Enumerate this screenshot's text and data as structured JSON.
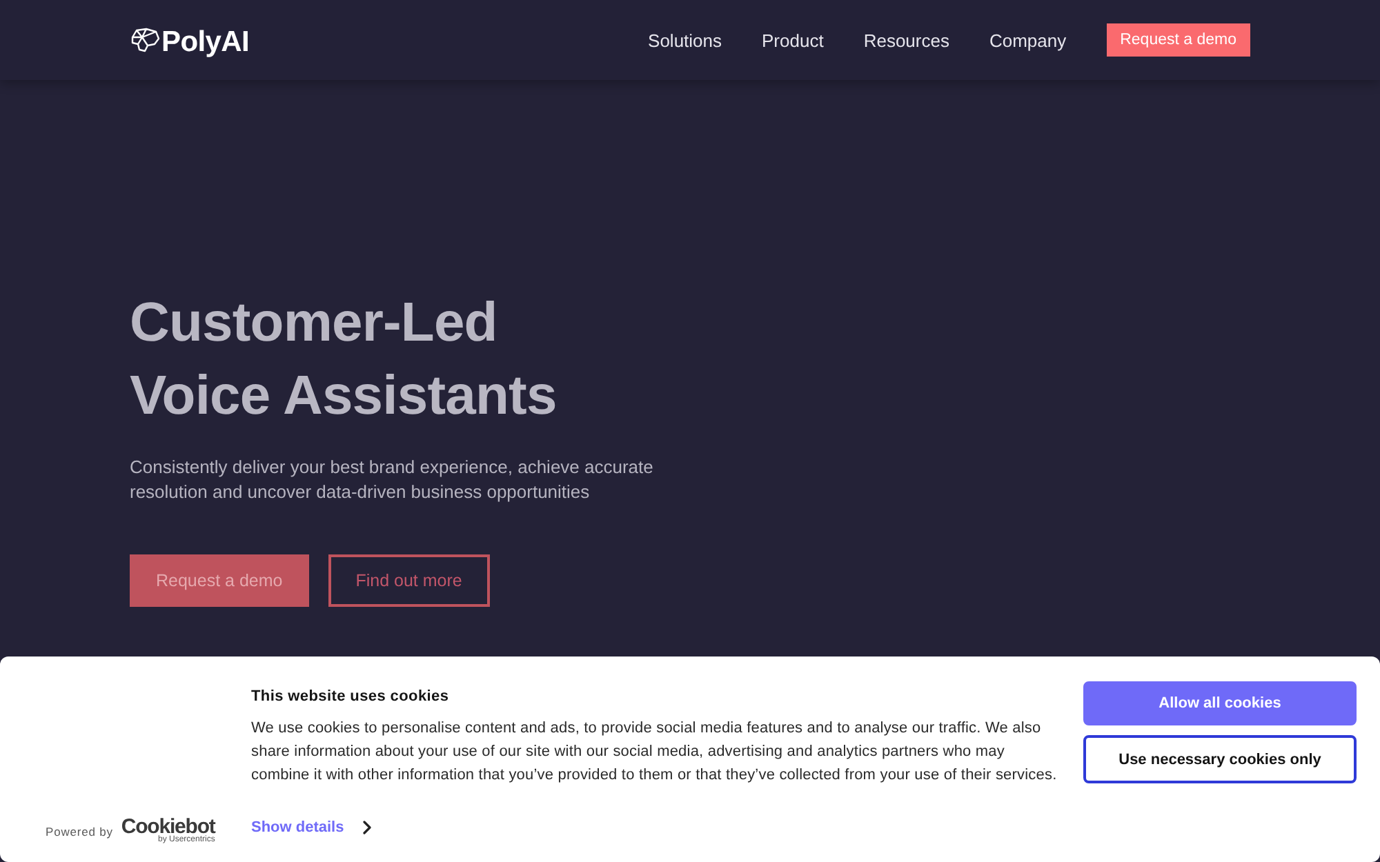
{
  "header": {
    "logo": "PolyAI",
    "nav": [
      "Solutions",
      "Product",
      "Resources",
      "Company"
    ],
    "cta": "Request a demo"
  },
  "hero": {
    "title": "Customer-Led Voice Assistants",
    "subtitle": "Consistently deliver your best brand experience, achieve accurate resolution and uncover data-driven business opportunities",
    "buttons": [
      {
        "label": "Request a demo",
        "kind": "primary"
      },
      {
        "label": "Find out more",
        "kind": "outline"
      }
    ]
  },
  "cookie_banner": {
    "title": "This website uses cookies",
    "body": "We use cookies to personalise content and ads, to provide social media features and to analyse our traffic. We also share information about your use of our site with our social media, advertising and analytics partners who may combine it with other information that you’ve provided to them or that they’ve collected from your use of their services.",
    "powered_by": "Powered by",
    "brand": "Cookiebot",
    "brand_tagline": "by Usercentrics",
    "details_link": "Show details",
    "buttons": [
      {
        "label": "Allow all cookies",
        "kind": "primary"
      },
      {
        "label": "Use necessary cookies only",
        "kind": "outline"
      }
    ]
  }
}
